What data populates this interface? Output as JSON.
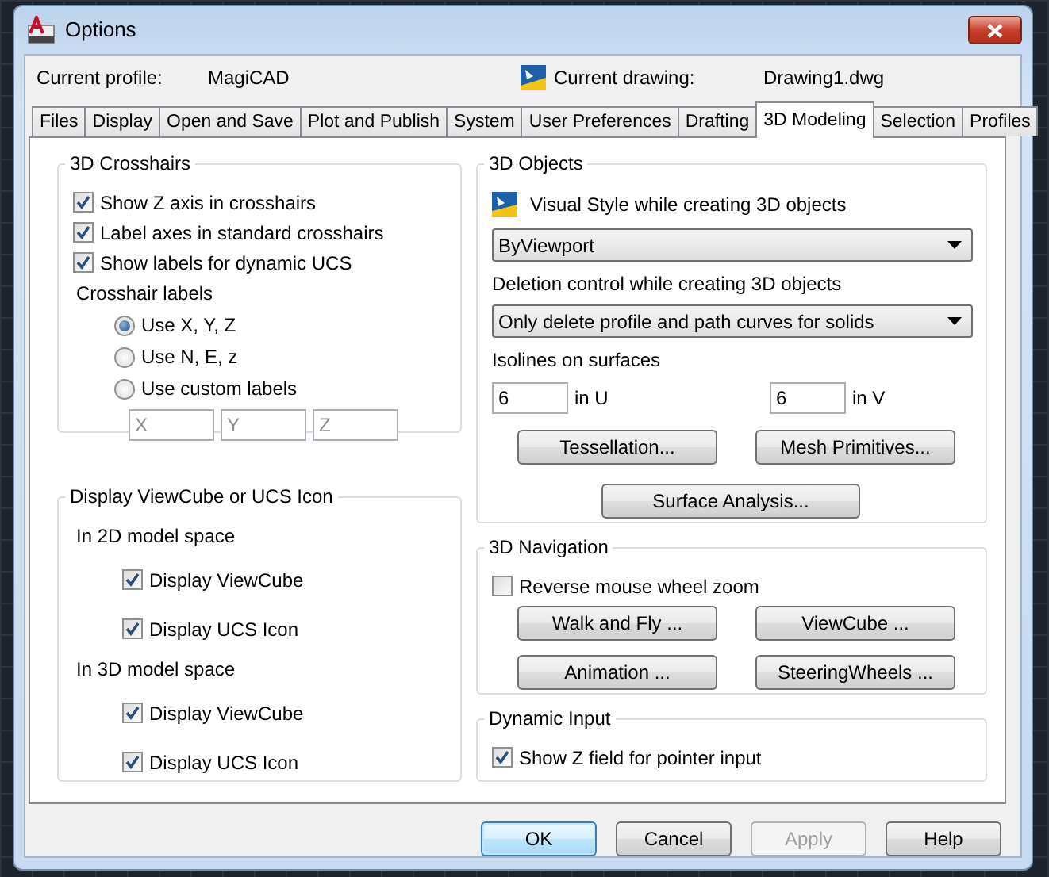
{
  "window": {
    "title": "Options"
  },
  "header": {
    "profile_label": "Current profile:",
    "profile": "MagiCAD",
    "drawing_label": "Current drawing:",
    "drawing": "Drawing1.dwg"
  },
  "tabs": [
    {
      "label": "Files",
      "selected": false
    },
    {
      "label": "Display",
      "selected": false
    },
    {
      "label": "Open and Save",
      "selected": false
    },
    {
      "label": "Plot and Publish",
      "selected": false
    },
    {
      "label": "System",
      "selected": false
    },
    {
      "label": "User Preferences",
      "selected": false
    },
    {
      "label": "Drafting",
      "selected": false
    },
    {
      "label": "3D Modeling",
      "selected": true
    },
    {
      "label": "Selection",
      "selected": false
    },
    {
      "label": "Profiles",
      "selected": false
    }
  ],
  "crosshairs": {
    "title": "3D Crosshairs",
    "options": [
      {
        "label": "Show Z axis in crosshairs",
        "checked": true
      },
      {
        "label": "Label axes in standard crosshairs",
        "checked": true
      },
      {
        "label": "Show labels for dynamic UCS",
        "checked": true
      }
    ],
    "labels_title": "Crosshair labels",
    "radios": [
      {
        "label": "Use X, Y, Z",
        "selected": true
      },
      {
        "label": "Use N, E, z",
        "selected": false
      },
      {
        "label": "Use custom labels",
        "selected": false
      }
    ],
    "custom_fields": [
      {
        "placeholder": "X"
      },
      {
        "placeholder": "Y"
      },
      {
        "placeholder": "Z"
      }
    ]
  },
  "viewcube": {
    "title": "Display ViewCube or UCS Icon",
    "groups": [
      {
        "label": "In 2D model space",
        "options": [
          {
            "label": "Display ViewCube",
            "checked": true
          },
          {
            "label": "Display UCS Icon",
            "checked": true
          }
        ]
      },
      {
        "label": "In 3D model space",
        "options": [
          {
            "label": "Display ViewCube",
            "checked": true
          },
          {
            "label": "Display UCS Icon",
            "checked": true
          }
        ]
      }
    ]
  },
  "objects": {
    "title": "3D Objects",
    "visual_style_label": "Visual Style while creating 3D objects",
    "visual_style": "ByViewport",
    "deletion_label": "Deletion control while creating 3D objects",
    "deletion": "Only delete profile and path curves for solids",
    "isolines_label": "Isolines on surfaces",
    "isolines": [
      {
        "value": "6",
        "unit": "in U"
      },
      {
        "value": "6",
        "unit": "in V"
      }
    ],
    "buttons": [
      "Tessellation...",
      "Mesh Primitives...",
      "Surface Analysis..."
    ]
  },
  "navigation": {
    "title": "3D Navigation",
    "options": [
      {
        "label": "Reverse mouse wheel zoom",
        "checked": false
      }
    ],
    "buttons": [
      "Walk and Fly ...",
      "ViewCube ...",
      "Animation ...",
      "SteeringWheels ..."
    ]
  },
  "dynamic_input": {
    "title": "Dynamic Input",
    "options": [
      {
        "label": "Show Z field for pointer input",
        "checked": true
      }
    ]
  },
  "footer_buttons": [
    {
      "label": "OK",
      "default": true,
      "disabled": false
    },
    {
      "label": "Cancel",
      "default": false,
      "disabled": false
    },
    {
      "label": "Apply",
      "default": false,
      "disabled": true
    },
    {
      "label": "Help",
      "default": false,
      "disabled": false
    }
  ]
}
